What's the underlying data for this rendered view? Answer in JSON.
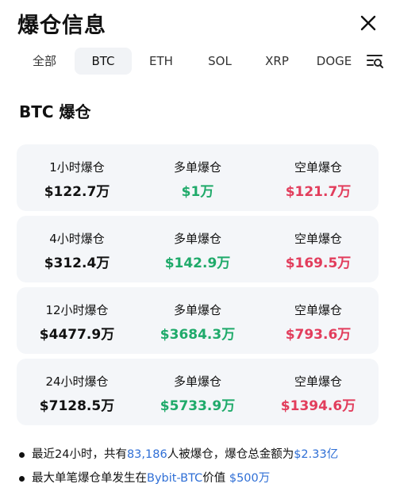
{
  "header": {
    "title": "爆仓信息"
  },
  "tabs": [
    "全部",
    "BTC",
    "ETH",
    "SOL",
    "XRP",
    "DOGE"
  ],
  "section": {
    "title": "BTC 爆仓"
  },
  "cards": [
    {
      "period": "1小时爆仓",
      "total": "$122.7万",
      "long_label": "多单爆仓",
      "long": "$1万",
      "short_label": "空单爆仓",
      "short": "$121.7万"
    },
    {
      "period": "4小时爆仓",
      "total": "$312.4万",
      "long_label": "多单爆仓",
      "long": "$142.9万",
      "short_label": "空单爆仓",
      "short": "$169.5万"
    },
    {
      "period": "12小时爆仓",
      "total": "$4477.9万",
      "long_label": "多单爆仓",
      "long": "$3684.3万",
      "short_label": "空单爆仓",
      "short": "$793.6万"
    },
    {
      "period": "24小时爆仓",
      "total": "$7128.5万",
      "long_label": "多单爆仓",
      "long": "$5733.9万",
      "short_label": "空单爆仓",
      "short": "$1394.6万"
    }
  ],
  "notes": {
    "line1": {
      "a": "最近24小时，共有",
      "count": "83,186",
      "b": "人被爆仓，爆仓总金额为",
      "amount": "$2.33亿"
    },
    "line2": {
      "a": "最大单笔爆仓单发生在",
      "where": "Bybit-BTC",
      "b": "价值 ",
      "value": "$500万"
    }
  },
  "colors": {
    "accent": "#2f6fd6",
    "long": "#1faa6a",
    "short": "#e23d5c",
    "card_bg": "#f4f6f9"
  },
  "icons": {
    "close": "close-icon",
    "filter": "filter-list-icon"
  }
}
